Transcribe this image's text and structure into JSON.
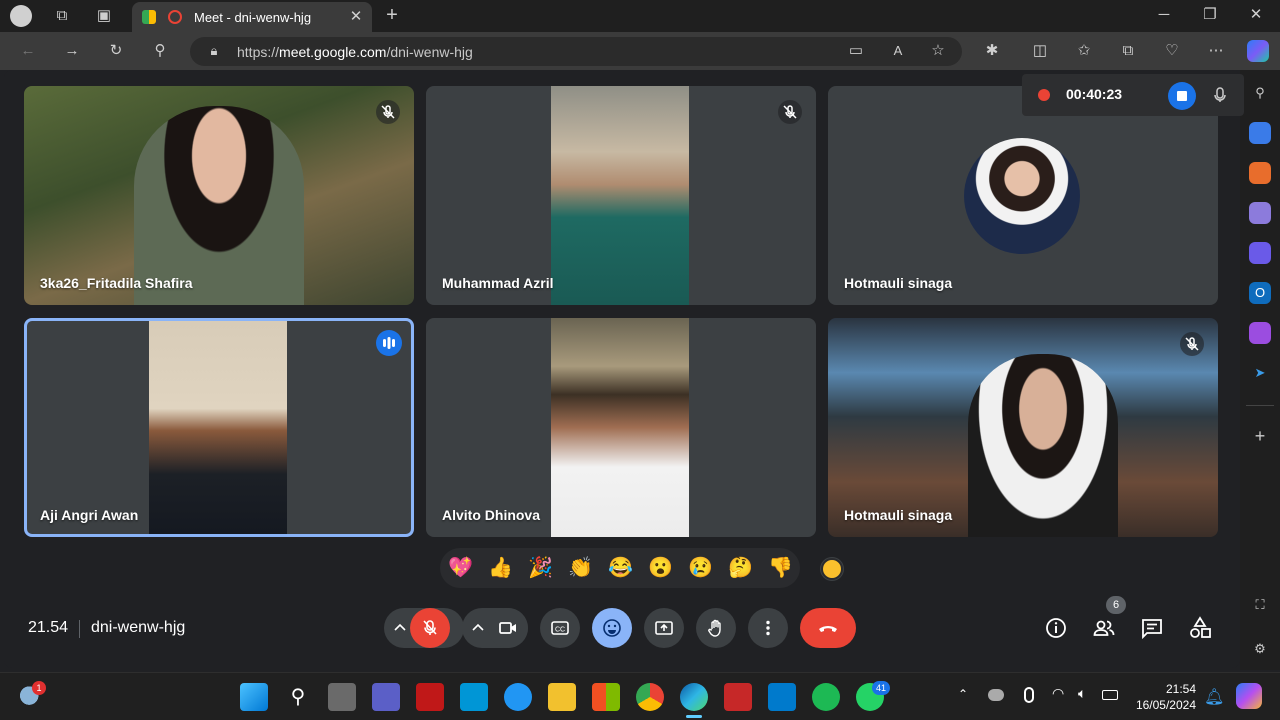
{
  "browser": {
    "tab_title": "Meet - dni-wenw-hjg",
    "url_prefix": "https://",
    "url_host": "meet.google.com",
    "url_path": "/dni-wenw-hjg"
  },
  "recording": {
    "time": "00:40:23"
  },
  "participants": [
    {
      "name": "3ka26_Fritadila Shafira",
      "muted": true
    },
    {
      "name": "Muhammad Azril",
      "muted": true
    },
    {
      "name": "Hotmauli sinaga",
      "muted": true
    },
    {
      "name": "Aji Angri Awan",
      "muted": false,
      "speaking": true
    },
    {
      "name": "Alvito Dhinova",
      "muted": false
    },
    {
      "name": "Hotmauli sinaga",
      "muted": true
    }
  ],
  "reactions": [
    "💖",
    "👍",
    "🎉",
    "👏",
    "😂",
    "😮",
    "😢",
    "🤔",
    "👎"
  ],
  "footer": {
    "time": "21.54",
    "meeting_code": "dni-wenw-hjg",
    "people_count": "6"
  },
  "taskbar": {
    "time": "21:54",
    "date": "16/05/2024",
    "weather_badge": "1",
    "whatsapp_badge": "41"
  },
  "colors": {
    "accent_blue": "#1a73e8",
    "mic_red": "#ea4335",
    "stage_bg": "#202124"
  }
}
